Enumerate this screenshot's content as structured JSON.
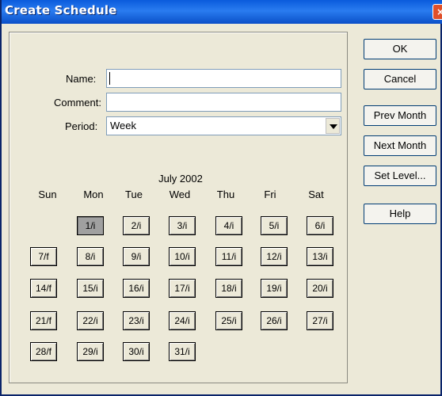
{
  "window": {
    "title": "Create Schedule",
    "close": "×"
  },
  "form": {
    "name_label": "Name:",
    "name_value": "",
    "comment_label": "Comment:",
    "comment_value": "",
    "period_label": "Period:",
    "period_value": "Week"
  },
  "calendar": {
    "month_label": "July 2002",
    "weekdays": [
      "Sun",
      "Mon",
      "Tue",
      "Wed",
      "Thu",
      "Fri",
      "Sat"
    ],
    "days": [
      "1/i",
      "2/i",
      "3/i",
      "4/i",
      "5/i",
      "6/i",
      "7/f",
      "8/i",
      "9/i",
      "10/i",
      "11/i",
      "12/i",
      "13/i",
      "14/f",
      "15/i",
      "16/i",
      "17/i",
      "18/i",
      "19/i",
      "20/i",
      "21/f",
      "22/i",
      "23/i",
      "24/i",
      "25/i",
      "26/i",
      "27/i",
      "28/f",
      "29/i",
      "30/i",
      "31/i"
    ],
    "selected_day": "1/i"
  },
  "buttons": {
    "ok": "OK",
    "cancel": "Cancel",
    "prev_month": "Prev Month",
    "next_month": "Next Month",
    "set_level": "Set Level...",
    "help": "Help"
  }
}
